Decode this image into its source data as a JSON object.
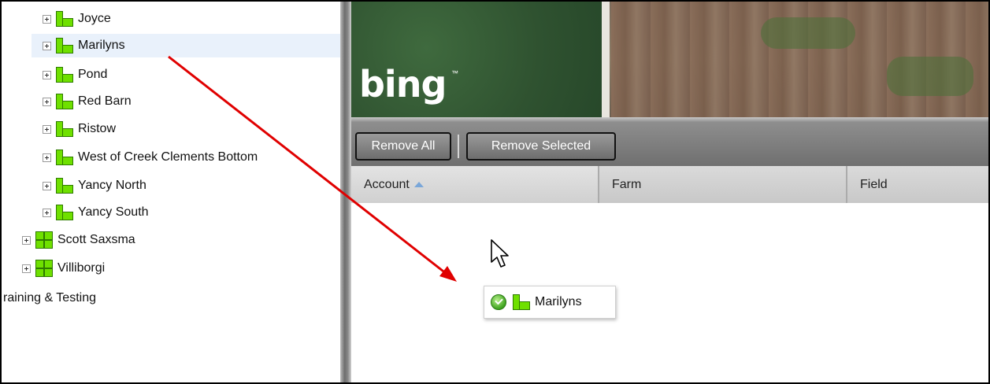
{
  "tree": {
    "fields": [
      {
        "label": "Joyce"
      },
      {
        "label": "Marilyns"
      },
      {
        "label": "Pond"
      },
      {
        "label": "Red Barn"
      },
      {
        "label": "Ristow"
      },
      {
        "label": "West of Creek Clements Bottom"
      },
      {
        "label": "Yancy North"
      },
      {
        "label": "Yancy South"
      }
    ],
    "farms": [
      {
        "label": "Scott Saxsma"
      },
      {
        "label": "Villiborgi"
      }
    ],
    "category": "raining & Testing"
  },
  "map": {
    "logo": "bing",
    "logo_tm": "™"
  },
  "toolbar": {
    "remove_all": "Remove All",
    "remove_selected": "Remove Selected"
  },
  "grid": {
    "columns": [
      {
        "label": "Account",
        "sorted": "ascending"
      },
      {
        "label": "Farm"
      },
      {
        "label": "Field"
      }
    ]
  },
  "drag": {
    "label": "Marilyns",
    "status_icon": "check-icon"
  },
  "colors": {
    "field_green": "#6fe000",
    "drag_arrow": "#e00000",
    "selection": "#e9f1fb"
  }
}
